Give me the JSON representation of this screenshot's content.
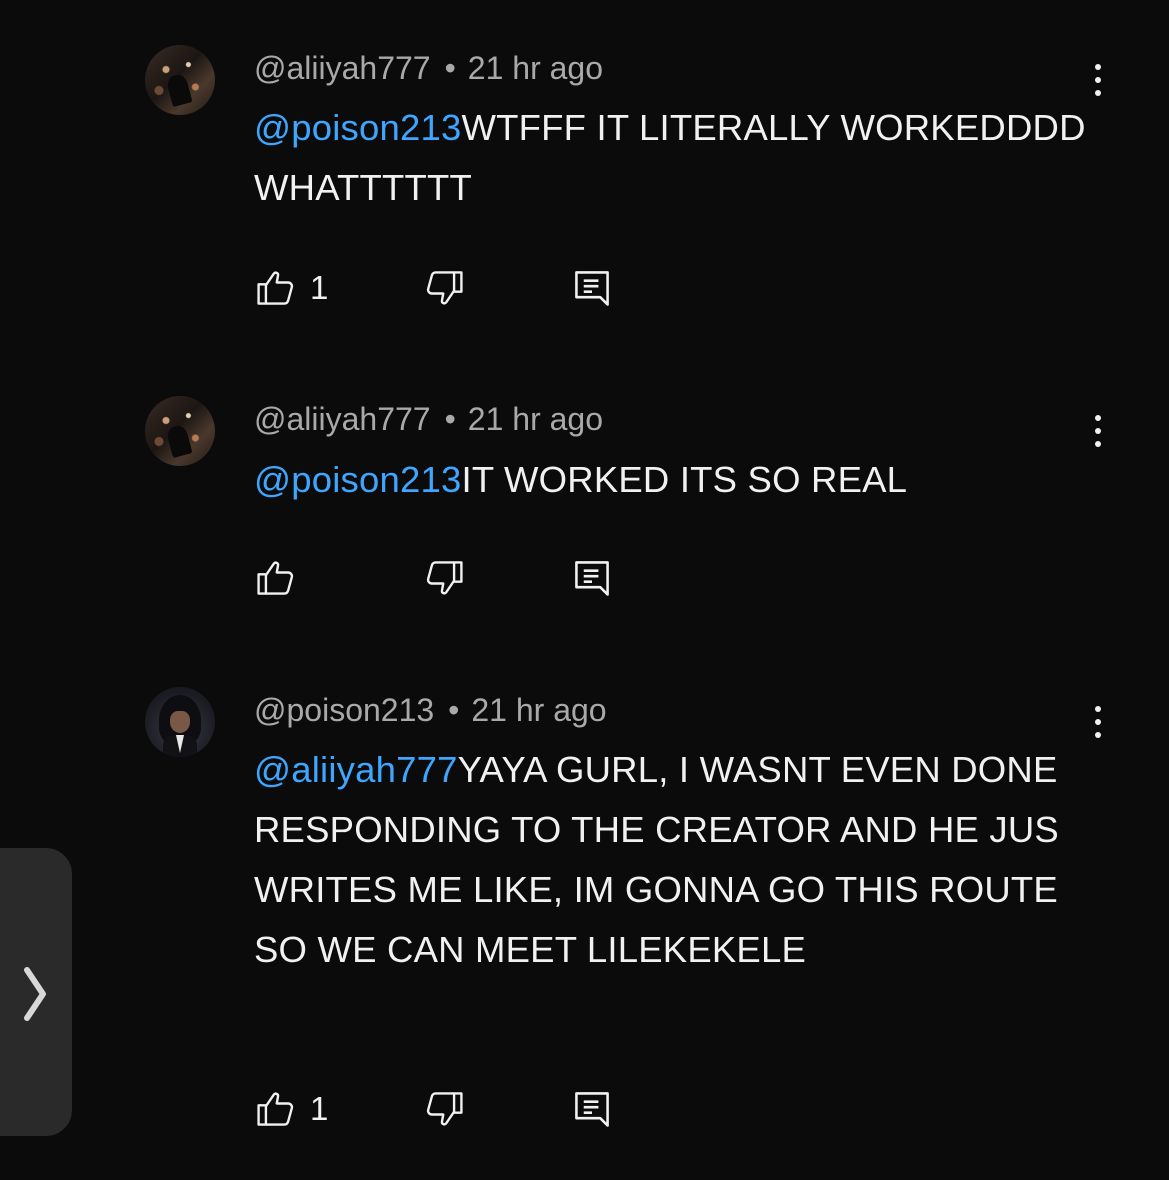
{
  "comments": [
    {
      "author": "@aliiyah777",
      "time": "21 hr ago",
      "mention": "@poison213",
      "text": "WTFFF IT LITERALLY WORKEDDDD WHATTTTTT",
      "likes": "1",
      "avatar": "city-photo-avatar"
    },
    {
      "author": "@aliiyah777",
      "time": "21 hr ago",
      "mention": "@poison213",
      "text": "IT WORKED ITS SO REAL",
      "likes": "",
      "avatar": "city-photo-avatar"
    },
    {
      "author": "@poison213",
      "time": "21 hr ago",
      "mention": "@aliiyah777",
      "text": "YAYA GURL, I WASNT EVEN DONE RESPONDING TO THE CREATOR AND HE JUS WRITES ME LIKE, IM GONNA GO THIS ROUTE SO WE CAN MEET LILEKEKELE",
      "likes": "1",
      "avatar": "anime-character-avatar"
    }
  ],
  "separator": "•",
  "icons": {
    "like": "thumbs-up-icon",
    "dislike": "thumbs-down-icon",
    "reply": "reply-comment-icon",
    "menu": "more-vertical-icon",
    "side_tab": "chevron-right-icon"
  },
  "colors": {
    "background": "#0b0b0b",
    "text": "#f1f1f1",
    "meta": "#a9a9a9",
    "mention": "#3ea6ff",
    "side_tab": "#2a2a2b"
  }
}
